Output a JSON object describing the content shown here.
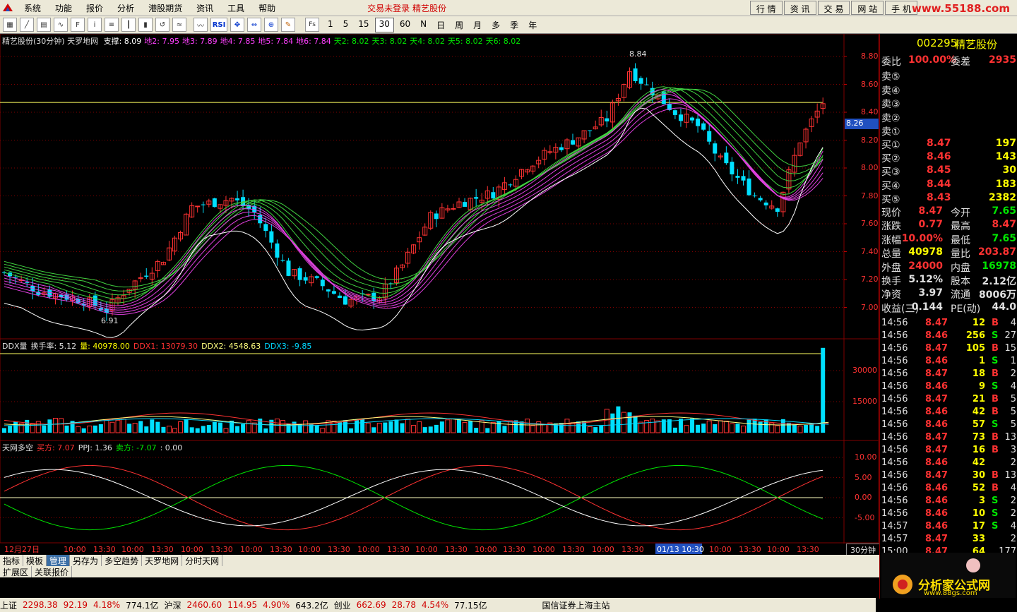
{
  "menu": {
    "items": [
      "系统",
      "功能",
      "报价",
      "分析",
      "港股期货",
      "资讯",
      "工具",
      "帮助"
    ],
    "status": "交易未登录  精艺股份",
    "right_tabs": [
      "行 情",
      "资 讯",
      "交 易",
      "网 站",
      "手 机"
    ],
    "brand_url": "www.55188.com"
  },
  "toolbar": {
    "periods": [
      "1",
      "5",
      "15",
      "30",
      "60",
      "N",
      "日",
      "周",
      "月",
      "多",
      "季",
      "年"
    ],
    "active_period": "30",
    "fs_label": "Fs",
    "rsi_label": "RSI"
  },
  "main_indicator": {
    "title": "精艺股份(30分钟) 天罗地网",
    "items": [
      {
        "text": "支撑: 8.09",
        "color": "#ffffff"
      },
      {
        "text": "地2: 7.95",
        "color": "#ff40ff"
      },
      {
        "text": "地3: 7.89",
        "color": "#ff40ff"
      },
      {
        "text": "地4: 7.85",
        "color": "#ff40ff"
      },
      {
        "text": "地5: 7.84",
        "color": "#ff40ff"
      },
      {
        "text": "地6: 7.84",
        "color": "#ff40ff"
      },
      {
        "text": "天2: 8.02",
        "color": "#00e600"
      },
      {
        "text": "天3: 8.02",
        "color": "#00e600"
      },
      {
        "text": "天4: 8.02",
        "color": "#00e600"
      },
      {
        "text": "天5: 8.02",
        "color": "#00e600"
      },
      {
        "text": "天6: 8.02",
        "color": "#00e600"
      }
    ],
    "high_label": "8.84",
    "low_label": "6.91",
    "cursor_price": "8.26",
    "yticks": [
      "8.80",
      "8.60",
      "8.40",
      "8.20",
      "8.00",
      "7.80",
      "7.60",
      "7.40",
      "7.20",
      "7.00"
    ]
  },
  "ddx_indicator": {
    "items": [
      {
        "text": "DDX量",
        "color": "#e0e0e0"
      },
      {
        "text": "换手率: 5.12",
        "color": "#e0e0e0"
      },
      {
        "text": "量: 40978.00",
        "color": "#ffff00"
      },
      {
        "text": "DDX1: 13079.30",
        "color": "#ff3232"
      },
      {
        "text": "DDX2: 4548.63",
        "color": "#ffff80"
      },
      {
        "text": "DDX3: -9.85",
        "color": "#00d8ff"
      }
    ],
    "yticks": [
      "30000",
      "15000"
    ]
  },
  "tw_indicator": {
    "items": [
      {
        "text": "天网多空",
        "color": "#e0e0e0"
      },
      {
        "text": "买方: 7.07",
        "color": "#ff3232"
      },
      {
        "text": "PPJ: 1.36",
        "color": "#e0e0e0"
      },
      {
        "text": "卖方: -7.07",
        "color": "#00e600"
      },
      {
        "text": ": 0.00",
        "color": "#e0e0e0"
      }
    ],
    "yticks": [
      "10.00",
      "5.00",
      "0.00",
      "-5.00"
    ]
  },
  "xaxis": {
    "labels": [
      "12月27日",
      "10:00",
      "13:30",
      "10:00",
      "13:30",
      "10:00",
      "13:30",
      "10:00",
      "13:30",
      "10:00",
      "13:30",
      "10:00",
      "13:30",
      "10:00",
      "13:30",
      "10:00",
      "13:30",
      "10:00",
      "13:30",
      "10:00",
      "13:30",
      "",
      "01/13 10:30",
      "10:00",
      "13:30",
      "10:00",
      "13:30"
    ],
    "highlight": "01/13 10:30",
    "period_label": "30分钟"
  },
  "bottom_tabs": [
    "指标",
    "模板",
    "管理",
    "另存为",
    "多空趋势",
    "天罗地网",
    "分时天网"
  ],
  "bottom_tabs_active": "管理",
  "bottom_tabs2": [
    "扩展区",
    "关联报价"
  ],
  "statusbar": [
    {
      "text": "上证",
      "color": "#000000"
    },
    {
      "text": "2298.38",
      "color": "#d00000"
    },
    {
      "text": "92.19",
      "color": "#d00000"
    },
    {
      "text": "4.18%",
      "color": "#d00000"
    },
    {
      "text": "774.1亿",
      "color": "#000000"
    },
    {
      "text": "沪深",
      "color": "#000000"
    },
    {
      "text": "2460.60",
      "color": "#d00000"
    },
    {
      "text": "114.95",
      "color": "#d00000"
    },
    {
      "text": "4.90%",
      "color": "#d00000"
    },
    {
      "text": "643.2亿",
      "color": "#000000"
    },
    {
      "text": "创业",
      "color": "#000000"
    },
    {
      "text": "662.69",
      "color": "#d00000"
    },
    {
      "text": "28.78",
      "color": "#d00000"
    },
    {
      "text": "4.54%",
      "color": "#d00000"
    },
    {
      "text": "77.15亿",
      "color": "#000000"
    },
    {
      "text": "国信证券上海主站",
      "color": "#000000"
    }
  ],
  "quote": {
    "code": "002295",
    "name": "精艺股份",
    "weibi_label": "委比",
    "weibi": "100.00%",
    "weicha_label": "委差",
    "weicha": "2935",
    "sell": [
      {
        "label": "卖⑤",
        "price": "",
        "vol": ""
      },
      {
        "label": "卖④",
        "price": "",
        "vol": ""
      },
      {
        "label": "卖③",
        "price": "",
        "vol": ""
      },
      {
        "label": "卖②",
        "price": "",
        "vol": ""
      },
      {
        "label": "卖①",
        "price": "",
        "vol": ""
      }
    ],
    "buy": [
      {
        "label": "买①",
        "price": "8.47",
        "vol": "197"
      },
      {
        "label": "买②",
        "price": "8.46",
        "vol": "143"
      },
      {
        "label": "买③",
        "price": "8.45",
        "vol": "30"
      },
      {
        "label": "买④",
        "price": "8.44",
        "vol": "183"
      },
      {
        "label": "买⑤",
        "price": "8.43",
        "vol": "2382"
      }
    ],
    "stats": [
      {
        "l1": "现价",
        "v1": "8.47",
        "c1": "#ff3232",
        "l2": "今开",
        "v2": "7.65",
        "c2": "#00e600"
      },
      {
        "l1": "涨跌",
        "v1": "0.77",
        "c1": "#ff3232",
        "l2": "最高",
        "v2": "8.47",
        "c2": "#ff3232"
      },
      {
        "l1": "涨幅",
        "v1": "10.00%",
        "c1": "#ff3232",
        "l2": "最低",
        "v2": "7.65",
        "c2": "#00e600"
      },
      {
        "l1": "总量",
        "v1": "40978",
        "c1": "#ffff00",
        "l2": "量比",
        "v2": "203.87",
        "c2": "#ff3232"
      },
      {
        "l1": "外盘",
        "v1": "24000",
        "c1": "#ff3232",
        "l2": "内盘",
        "v2": "16978",
        "c2": "#00e600"
      },
      {
        "l1": "换手",
        "v1": "5.12%",
        "c1": "#e0e0e0",
        "l2": "股本",
        "v2": "2.12亿",
        "c2": "#e0e0e0"
      },
      {
        "l1": "净资",
        "v1": "3.97",
        "c1": "#e0e0e0",
        "l2": "流通",
        "v2": "8006万",
        "c2": "#e0e0e0"
      },
      {
        "l1": "收益(三)",
        "v1": "0.144",
        "c1": "#e0e0e0",
        "l2": "PE(动)",
        "v2": "44.0",
        "c2": "#e0e0e0"
      }
    ],
    "ticks": [
      {
        "t": "14:56",
        "p": "8.47",
        "v": "12",
        "bs": "B",
        "n": "4"
      },
      {
        "t": "14:56",
        "p": "8.46",
        "v": "256",
        "bs": "S",
        "n": "27"
      },
      {
        "t": "14:56",
        "p": "8.47",
        "v": "105",
        "bs": "B",
        "n": "15"
      },
      {
        "t": "14:56",
        "p": "8.46",
        "v": "1",
        "bs": "S",
        "n": "1"
      },
      {
        "t": "14:56",
        "p": "8.47",
        "v": "18",
        "bs": "B",
        "n": "2"
      },
      {
        "t": "14:56",
        "p": "8.46",
        "v": "9",
        "bs": "S",
        "n": "4"
      },
      {
        "t": "14:56",
        "p": "8.47",
        "v": "21",
        "bs": "B",
        "n": "5"
      },
      {
        "t": "14:56",
        "p": "8.46",
        "v": "42",
        "bs": "B",
        "n": "5"
      },
      {
        "t": "14:56",
        "p": "8.46",
        "v": "57",
        "bs": "S",
        "n": "5"
      },
      {
        "t": "14:56",
        "p": "8.47",
        "v": "73",
        "bs": "B",
        "n": "13"
      },
      {
        "t": "14:56",
        "p": "8.47",
        "v": "16",
        "bs": "B",
        "n": "3"
      },
      {
        "t": "14:56",
        "p": "8.46",
        "v": "42",
        "bs": "",
        "n": "2"
      },
      {
        "t": "14:56",
        "p": "8.47",
        "v": "30",
        "bs": "B",
        "n": "13"
      },
      {
        "t": "14:56",
        "p": "8.46",
        "v": "52",
        "bs": "B",
        "n": "4"
      },
      {
        "t": "14:56",
        "p": "8.46",
        "v": "3",
        "bs": "S",
        "n": "2"
      },
      {
        "t": "14:56",
        "p": "8.46",
        "v": "10",
        "bs": "S",
        "n": "2"
      },
      {
        "t": "14:57",
        "p": "8.46",
        "v": "17",
        "bs": "S",
        "n": "4"
      },
      {
        "t": "14:57",
        "p": "8.47",
        "v": "33",
        "bs": "",
        "n": "2"
      },
      {
        "t": "15:00",
        "p": "8.47",
        "v": "64",
        "bs": "",
        "n": "177"
      }
    ]
  },
  "brand": {
    "name": "分析家公式网",
    "url": "www.88gs.com"
  }
}
